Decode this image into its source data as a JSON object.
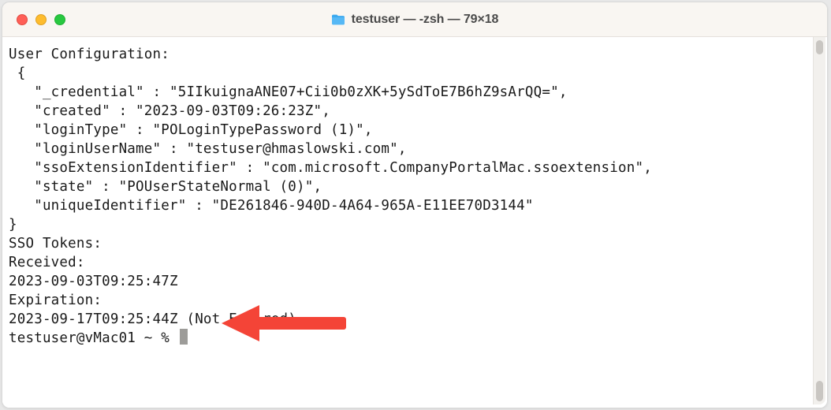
{
  "window": {
    "title": "testuser — -zsh — 79×18"
  },
  "output": {
    "header": "User Configuration:",
    "open_brace": " {",
    "entries": [
      {
        "key": "_credential",
        "value": "5IIkuignaANE07+Cii0b0zXK+5ySdToE7B6hZ9sArQQ="
      },
      {
        "key": "created",
        "value": "2023-09-03T09:26:23Z"
      },
      {
        "key": "loginType",
        "value": "POLoginTypePassword (1)"
      },
      {
        "key": "loginUserName",
        "value": "testuser@hmaslowski.com"
      },
      {
        "key": "ssoExtensionIdentifier",
        "value": "com.microsoft.CompanyPortalMac.ssoextension"
      },
      {
        "key": "state",
        "value": "POUserStateNormal (0)"
      },
      {
        "key": "uniqueIdentifier",
        "value": "DE261846-940D-4A64-965A-E11EE70D3144"
      }
    ],
    "close_brace": "}",
    "blank1": "",
    "sso_header": "SSO Tokens:",
    "received_label": "Received:",
    "received_value": "2023-09-03T09:25:47Z",
    "expiration_label": "Expiration:",
    "expiration_value": "2023-09-17T09:25:44Z (Not Expired)",
    "blank2": ""
  },
  "prompt": {
    "text": "testuser@vMac01 ~ % "
  },
  "annotation": {
    "arrow_color": "#f44437"
  }
}
